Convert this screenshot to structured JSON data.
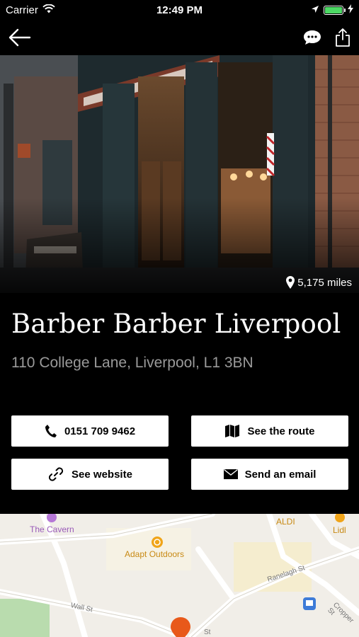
{
  "status_bar": {
    "carrier": "Carrier",
    "time": "12:49 PM",
    "battery_level": 1.0
  },
  "nav": {
    "back_icon": "arrow-left-icon",
    "chat_icon": "chat-bubble-icon",
    "share_icon": "share-icon"
  },
  "hero": {
    "distance": "5,175 miles"
  },
  "place": {
    "name": "Barber Barber Liverpool",
    "address": "110 College Lane, Liverpool, L1 3BN"
  },
  "actions": {
    "call_label": "0151 709 9462",
    "route_label": "See the route",
    "website_label": "See website",
    "email_label": "Send an email"
  },
  "map": {
    "labels": {
      "cavern": "The Cavern",
      "adapt": "Adapt Outdoors",
      "aldi": "ALDI",
      "lidl": "Lidl",
      "ranelagh": "Ranelagh St",
      "wall": "Wall St",
      "cropper": "Cropper St",
      "st": "St"
    }
  },
  "colors": {
    "background": "#000000",
    "address_gray": "#9a9a9a",
    "battery_green": "#4cd964",
    "map_bg": "#f1eee8",
    "pin_orange": "#e8591a"
  }
}
